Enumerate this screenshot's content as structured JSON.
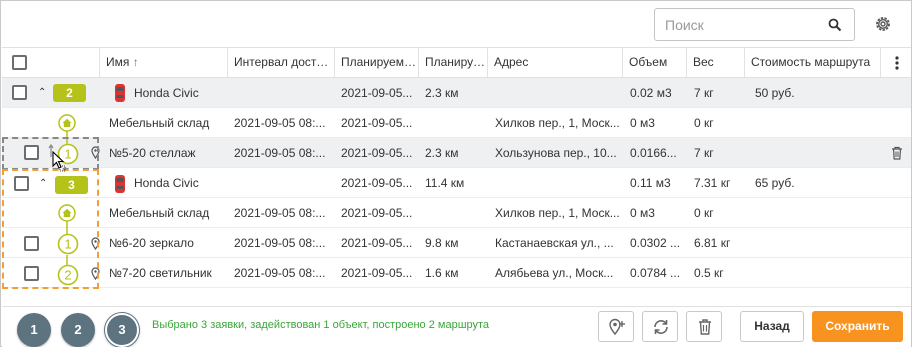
{
  "search": {
    "placeholder": "Поиск"
  },
  "columns": [
    {
      "key": "name",
      "label": "Имя",
      "sort_indicator": "↑"
    },
    {
      "key": "interval",
      "label": "Интервал доставки"
    },
    {
      "key": "planned_time",
      "label": "Планируемое время"
    },
    {
      "key": "planned_mileage",
      "label": "Планируемый пробег"
    },
    {
      "key": "address",
      "label": "Адрес"
    },
    {
      "key": "volume",
      "label": "Объем"
    },
    {
      "key": "weight",
      "label": "Вес"
    },
    {
      "key": "cost",
      "label": "Стоимость маршрута"
    }
  ],
  "rows": [
    {
      "type": "route",
      "badge": "2",
      "name": "Honda Civic",
      "interval": "",
      "planned_time": "2021-09-05...",
      "mileage": "2.3 км",
      "address": "",
      "volume": "0.02 м3",
      "weight": "7 кг",
      "cost": "50 руб."
    },
    {
      "type": "warehouse",
      "name": "Мебельный склад",
      "interval": "2021-09-05 08:...",
      "planned_time": "2021-09-05...",
      "mileage": "",
      "address": "Хилков пер., 1, Моск...",
      "volume": "0 м3",
      "weight": "0 кг",
      "cost": ""
    },
    {
      "type": "order",
      "step": "1",
      "name": "№5-20 стеллаж",
      "interval": "2021-09-05 08:...",
      "planned_time": "2021-09-05...",
      "mileage": "2.3 км",
      "address": "Хользунова пер., 10...",
      "volume": "0.0166...",
      "weight": "7 кг",
      "cost": ""
    },
    {
      "type": "route",
      "badge": "3",
      "name": "Honda Civic",
      "interval": "",
      "planned_time": "2021-09-05...",
      "mileage": "11.4 км",
      "address": "",
      "volume": "0.11 м3",
      "weight": "7.31 кг",
      "cost": "65 руб."
    },
    {
      "type": "warehouse",
      "name": "Мебельный склад",
      "interval": "2021-09-05 08:...",
      "planned_time": "2021-09-05...",
      "mileage": "",
      "address": "Хилков пер., 1, Моск...",
      "volume": "0 м3",
      "weight": "0 кг",
      "cost": ""
    },
    {
      "type": "order",
      "step": "1",
      "name": "№6-20 зеркало",
      "interval": "2021-09-05 08:...",
      "planned_time": "2021-09-05...",
      "mileage": "9.8 км",
      "address": "Кастанаевская ул., ...",
      "volume": "0.0302 ...",
      "weight": "6.81 кг",
      "cost": ""
    },
    {
      "type": "order",
      "step": "2",
      "name": "№7-20 светильник",
      "interval": "2021-09-05 08:...",
      "planned_time": "2021-09-05...",
      "mileage": "1.6 км",
      "address": "Алябьева ул., Моск...",
      "volume": "0.0784 ...",
      "weight": "0.5 кг",
      "cost": ""
    }
  ],
  "footer": {
    "steps": [
      "1",
      "2",
      "3"
    ],
    "active_step": "3",
    "status": "Выбрано 3 заявки, задействован 1 объект, построено 2 маршрута",
    "back_label": "Назад",
    "save_label": "Сохранить"
  },
  "colors": {
    "accent_green": "#b5c219",
    "save_orange": "#f7931e",
    "status_green": "#3aa63a",
    "step_circle": "#5d7380",
    "drag_dash": "#f0a030"
  },
  "icons": {
    "search": "search-icon",
    "settings": "gear-icon",
    "warehouse": "home-icon",
    "vehicle": "car-icon",
    "location": "pin-icon",
    "delete": "trash-icon"
  }
}
